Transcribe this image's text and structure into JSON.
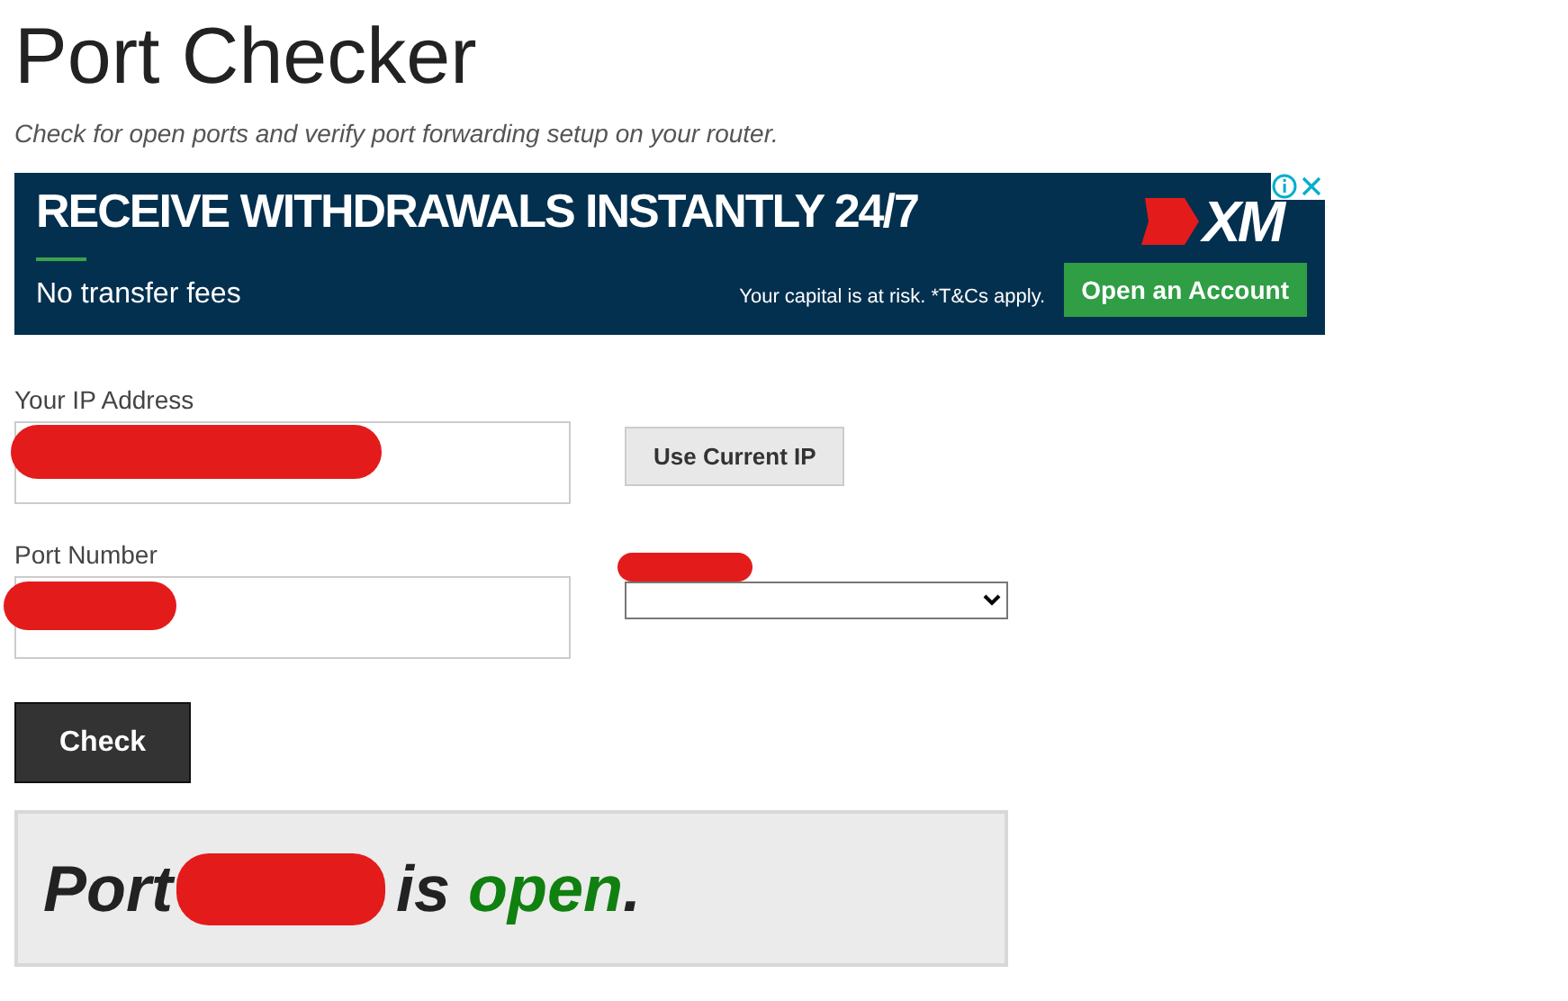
{
  "page": {
    "title": "Port Checker",
    "subtitle": "Check for open ports and verify port forwarding setup on your router."
  },
  "ad": {
    "headline": "RECEIVE WITHDRAWALS INSTANTLY 24/7",
    "tagline": "No transfer fees",
    "disclaimer": "Your capital is at risk. *T&Cs apply.",
    "logo": "XM",
    "cta": "Open an Account"
  },
  "form": {
    "ip_label": "Your IP Address",
    "use_ip_button": "Use Current IP",
    "port_label": "Port Number",
    "submit": "Check"
  },
  "result": {
    "prefix": "Port",
    "verb": "is",
    "status": "open",
    "open": true,
    "end": "."
  }
}
